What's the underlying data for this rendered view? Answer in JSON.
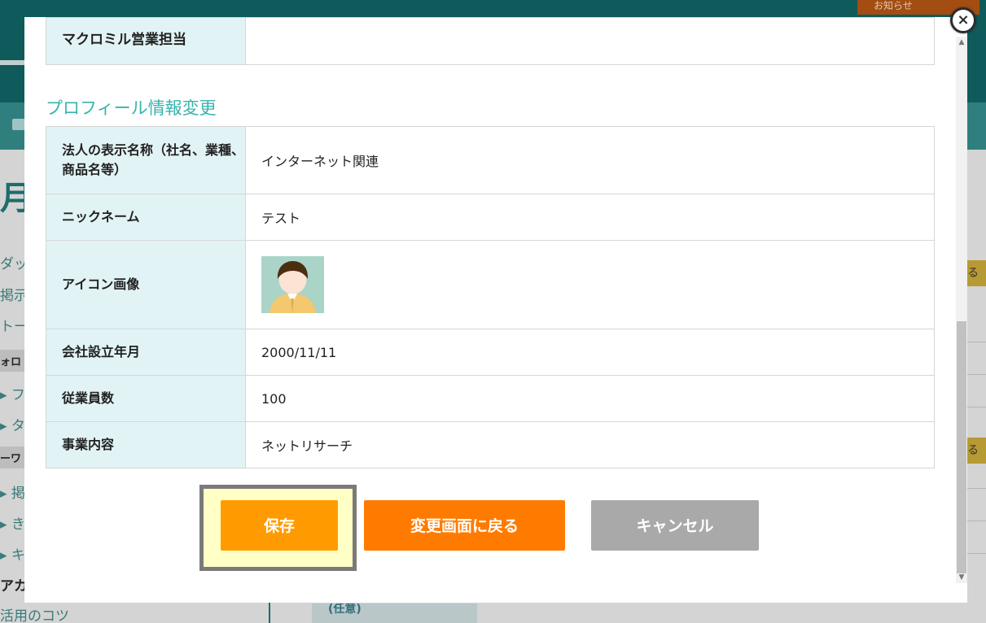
{
  "background": {
    "notice_label": "お知らせ",
    "title_char": "月",
    "sidebar": {
      "items": [
        "ダッ",
        "掲示",
        "トー",
        "▸ フ",
        "▸ タ",
        "▸ 掲",
        "▸ き",
        "▸ キ"
      ],
      "headings": [
        "ォロ",
        "ーワ"
      ],
      "account_heading": "アカ",
      "tips_link": "活用のコツ"
    },
    "right_button_label": "る",
    "bottom_cell_label": "(任意)"
  },
  "modal": {
    "top_row_label": "マクロミル営業担当",
    "section_title": "プロフィール情報変更",
    "rows": [
      {
        "label": "法人の表示名称（社名、業種、商品名等）",
        "value": "インターネット関連"
      },
      {
        "label": "ニックネーム",
        "value": "テスト"
      },
      {
        "label": "アイコン画像",
        "value": ""
      },
      {
        "label": "会社設立年月",
        "value": "2000/11/11"
      },
      {
        "label": "従業員数",
        "value": "100"
      },
      {
        "label": "事業内容",
        "value": "ネットリサーチ"
      }
    ],
    "buttons": {
      "save": "保存",
      "back": "変更画面に戻る",
      "cancel": "キャンセル"
    },
    "close_symbol": "×"
  },
  "colors": {
    "accent_teal": "#38b3ad",
    "save_orange": "#ff9b00",
    "back_orange": "#ff7b00",
    "cancel_gray": "#a9a9a9",
    "label_bg": "#e2f3f6"
  },
  "icons": {
    "avatar": "user-avatar-illustration",
    "close": "close-icon"
  }
}
